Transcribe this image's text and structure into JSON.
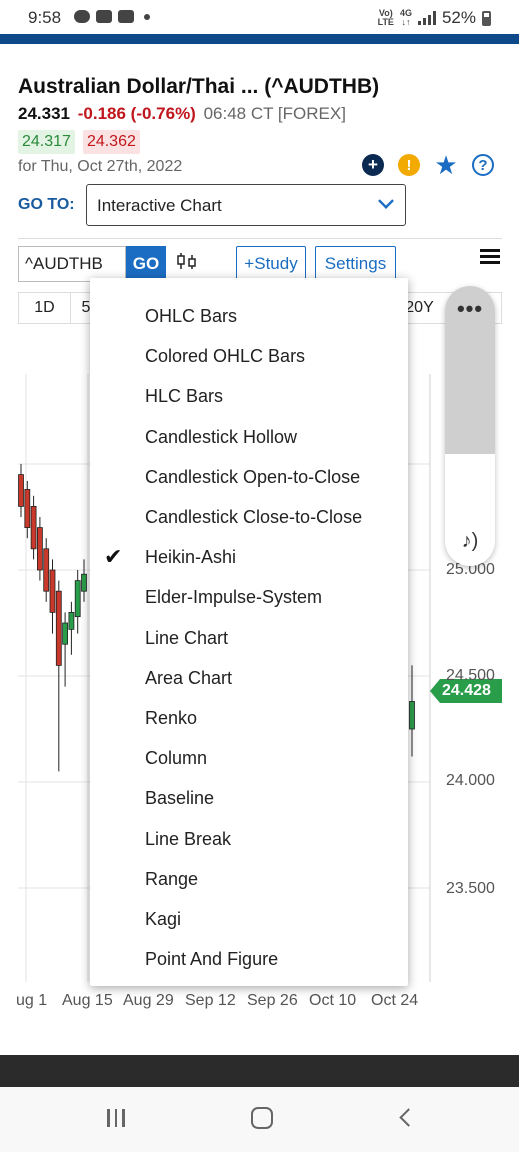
{
  "status_bar": {
    "time": "9:58",
    "network_top": "Vo)",
    "network_bottom": "LTE",
    "network_gen": "4G",
    "battery": "52%"
  },
  "quote": {
    "title": "Australian Dollar/Thai ... (^AUDTHB)",
    "last": "24.331",
    "change": "-0.186 (-0.76%)",
    "time_exchange": "06:48 CT [FOREX]",
    "bid": "24.317",
    "ask": "24.362",
    "date_line": "for Thu, Oct 27th, 2022"
  },
  "goto": {
    "label": "GO TO:",
    "value": "Interactive Chart"
  },
  "toolbar": {
    "symbol_value": "^AUDTHB",
    "go_label": "GO",
    "study_label": "+Study",
    "settings_label": "Settings"
  },
  "timeframes": {
    "first": "1D",
    "second": "5",
    "last": "20Y"
  },
  "chart_menu": {
    "items": [
      "OHLC Bars",
      "Colored OHLC Bars",
      "HLC Bars",
      "Candlestick Hollow",
      "Candlestick Open-to-Close",
      "Candlestick Close-to-Close",
      "Heikin-Ashi",
      "Elder-Impulse-System",
      "Line Chart",
      "Area Chart",
      "Renko",
      "Column",
      "Baseline",
      "Line Break",
      "Range",
      "Kagi",
      "Point And Figure"
    ],
    "selected": "Heikin-Ashi"
  },
  "chart": {
    "current_price_label": "24.428",
    "y_ticks": [
      "25.000",
      "24.500",
      "24.000",
      "23.500"
    ],
    "x_ticks": [
      "ug 1",
      "Aug 15",
      "Aug 29",
      "Sep 12",
      "Sep 26",
      "Oct 10",
      "Oct 24"
    ],
    "up_color": "#2a9d4a",
    "down_color": "#c8382b"
  },
  "chart_data": {
    "type": "candlestick",
    "y_ticks": [
      25.0,
      24.5,
      24.0,
      23.5
    ],
    "x_ticks": [
      "ug 1",
      "Aug 15",
      "Aug 29",
      "Sep 12",
      "Sep 26",
      "Oct 10",
      "Oct 24"
    ],
    "current_price": 24.428,
    "candles": [
      {
        "open": 25.45,
        "close": 25.3,
        "high": 25.5,
        "low": 25.25
      },
      {
        "open": 25.38,
        "close": 25.2,
        "high": 25.42,
        "low": 25.15
      },
      {
        "open": 25.3,
        "close": 25.1,
        "high": 25.35,
        "low": 25.05
      },
      {
        "open": 25.2,
        "close": 25.0,
        "high": 25.25,
        "low": 24.95
      },
      {
        "open": 25.1,
        "close": 24.9,
        "high": 25.15,
        "low": 24.85
      },
      {
        "open": 25.0,
        "close": 24.8,
        "high": 25.05,
        "low": 24.7
      },
      {
        "open": 24.9,
        "close": 24.55,
        "high": 24.95,
        "low": 24.05
      },
      {
        "open": 24.65,
        "close": 24.75,
        "high": 24.8,
        "low": 24.45
      },
      {
        "open": 24.72,
        "close": 24.8,
        "high": 24.85,
        "low": 24.6
      },
      {
        "open": 24.78,
        "close": 24.95,
        "high": 25.0,
        "low": 24.7
      },
      {
        "open": 24.9,
        "close": 24.98,
        "high": 25.05,
        "low": 24.85
      }
    ],
    "last_candle": {
      "open": 24.25,
      "close": 24.38,
      "high": 24.55,
      "low": 24.12
    }
  }
}
